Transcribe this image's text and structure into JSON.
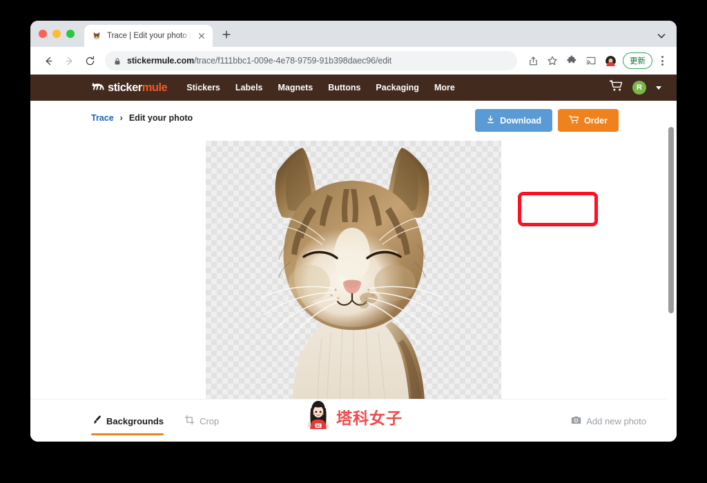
{
  "browser": {
    "tab": {
      "title": "Trace | Edit your photo | Sticker",
      "favicon_icon": "mule-favicon",
      "close_icon": "close-icon"
    },
    "new_tab_icon": "plus-icon",
    "tabstrip_chevron_icon": "chevron-down-icon",
    "toolbar": {
      "back_icon": "back-arrow-icon",
      "forward_icon": "forward-arrow-icon",
      "reload_icon": "reload-icon",
      "lock_icon": "lock-icon",
      "url_domain": "stickermule.com",
      "url_path": "/trace/f111bbc1-009e-4e78-9759-91b398daec96/edit",
      "url_full": "stickermule.com/trace/f111bbc1-009e-4e78-9759-91b398daec96/edit",
      "share_icon": "share-icon",
      "bookmark_icon": "star-icon",
      "extensions_icon": "puzzle-icon",
      "cast_icon": "cast-icon",
      "profile_icon": "profile-avatar-icon",
      "update_label": "更新",
      "menu_icon": "three-dot-menu-icon"
    }
  },
  "site": {
    "brand": {
      "logo_icon": "mule-logo-icon",
      "name_primary": "sticker",
      "name_accent": "mule"
    },
    "nav": [
      {
        "label": "Stickers"
      },
      {
        "label": "Labels"
      },
      {
        "label": "Magnets"
      },
      {
        "label": "Buttons"
      },
      {
        "label": "Packaging"
      },
      {
        "label": "More"
      }
    ],
    "header_right": {
      "cart_icon": "shopping-cart-icon",
      "avatar_initial": "R",
      "avatar_color": "#7ab648",
      "account_chevron_icon": "chevron-down-icon"
    },
    "header_bg": "#422a1e"
  },
  "breadcrumb": {
    "link_label": "Trace",
    "separator": "›",
    "current_label": "Edit your photo"
  },
  "actions": {
    "download_label": "Download",
    "download_icon": "download-icon",
    "download_color": "#5b9bd5",
    "order_label": "Order",
    "order_icon": "shopping-cart-icon",
    "order_color": "#f0821e",
    "highlight_color": "#ff0f22"
  },
  "canvas": {
    "image_alt": "Cat photo with background removed",
    "background": "transparent-checkerboard"
  },
  "tools": {
    "tabs": [
      {
        "label": "Backgrounds",
        "icon": "paintbrush-icon",
        "active": true
      },
      {
        "label": "Crop",
        "icon": "crop-icon",
        "active": false
      }
    ],
    "add_photo_label": "Add new photo",
    "add_photo_icon": "camera-icon",
    "active_underline_color": "#f0821e"
  },
  "watermark": {
    "text": "塔科女子",
    "icon": "girl-avatar-icon",
    "shirt_text": "3C",
    "color": "#ee4b4b"
  },
  "scrollbar": {
    "orientation": "vertical"
  }
}
